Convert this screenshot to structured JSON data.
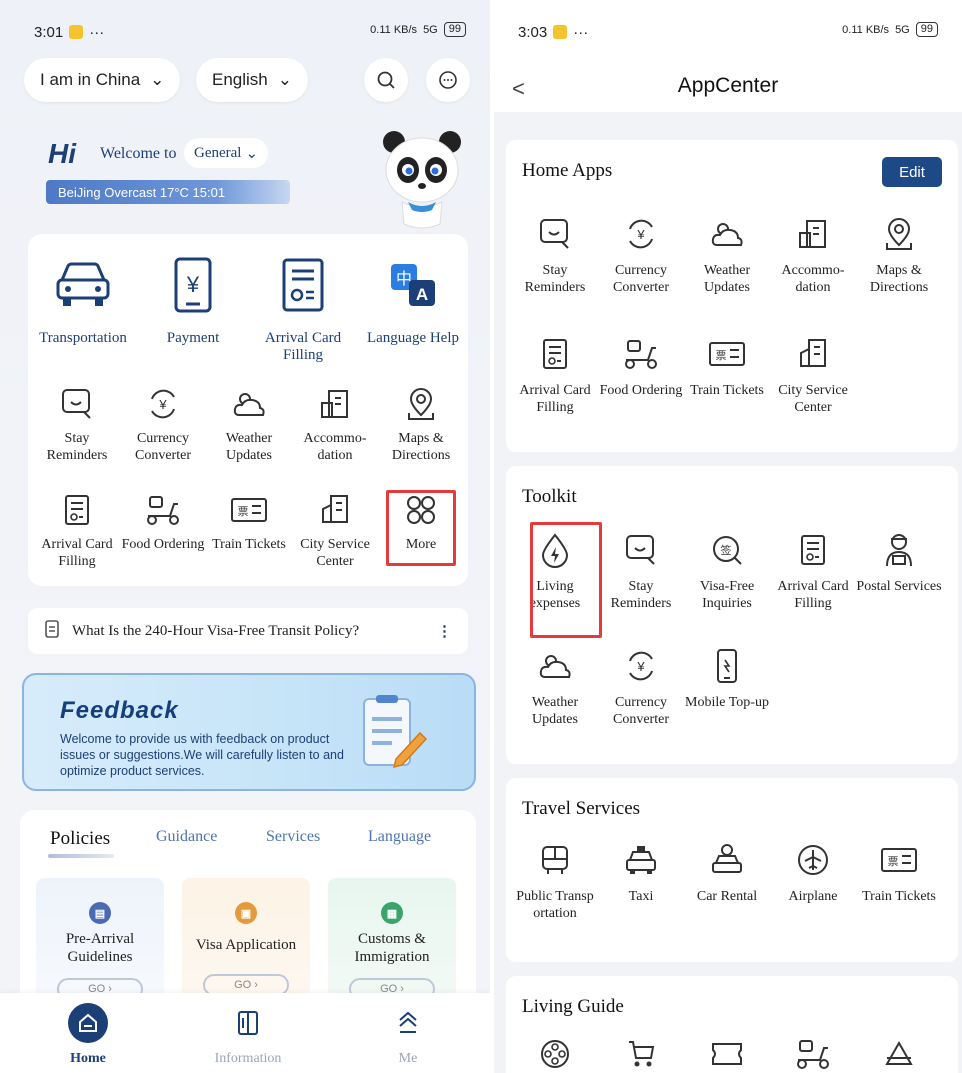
{
  "left": {
    "status": {
      "time": "3:01",
      "dots": "···",
      "network": "0.11 KB/s",
      "signal": "5G",
      "battery": "99"
    },
    "location_select": "I am in China",
    "language_select": "English",
    "greeting": {
      "hi": "Hi",
      "welcome": "Welcome to",
      "mode": "General"
    },
    "weather": "BeiJing Overcast 17°C  15:01",
    "main_services": [
      {
        "label": "Transportation"
      },
      {
        "label": "Payment"
      },
      {
        "label": "Arrival Card Filling"
      },
      {
        "label": "Language Help"
      }
    ],
    "apps_row1": [
      {
        "label": "Stay Reminders"
      },
      {
        "label": "Currency Converter"
      },
      {
        "label": "Weather Updates"
      },
      {
        "label": "Accommo- dation"
      },
      {
        "label": "Maps & Directions"
      }
    ],
    "apps_row2": [
      {
        "label": "Arrival Card Filling"
      },
      {
        "label": "Food Ordering"
      },
      {
        "label": "Train Tickets"
      },
      {
        "label": "City Service Center"
      },
      {
        "label": "More"
      }
    ],
    "policy_notice": "What Is the 240-Hour Visa-Free Transit Policy?",
    "policy_more": "⋮",
    "feedback": {
      "title": "Feedback",
      "description": "Welcome to provide us with feedback on product issues or suggestions.We will carefully listen to and optimize product services."
    },
    "tabs": [
      "Policies",
      "Guidance",
      "Services",
      "Language"
    ],
    "guide_cards": [
      {
        "title": "Pre-Arrival Guidelines",
        "go": "GO",
        "color": "#4a6bb3"
      },
      {
        "title": "Visa Application",
        "go": "GO",
        "color": "#e39a3b"
      },
      {
        "title": "Customs & Immigration",
        "go": "GO",
        "color": "#3aa46a"
      }
    ],
    "bottom_nav": [
      {
        "label": "Home",
        "icon": "home-icon"
      },
      {
        "label": "Information",
        "icon": "book-icon"
      },
      {
        "label": "Me",
        "icon": "me-icon"
      }
    ]
  },
  "right": {
    "status": {
      "time": "3:03",
      "dots": "···",
      "network": "0.11 KB/s",
      "signal": "5G",
      "battery": "99"
    },
    "back": "<",
    "title": "AppCenter",
    "home_apps": {
      "title": "Home Apps",
      "edit": "Edit",
      "row1": [
        {
          "label": "Stay Reminders"
        },
        {
          "label": "Currency Converter"
        },
        {
          "label": "Weather Updates"
        },
        {
          "label": "Accommo- dation"
        },
        {
          "label": "Maps & Directions"
        }
      ],
      "row2": [
        {
          "label": "Arrival Card Filling"
        },
        {
          "label": "Food Ordering"
        },
        {
          "label": "Train Tickets"
        },
        {
          "label": "City Service Center"
        }
      ]
    },
    "toolkit": {
      "title": "Toolkit",
      "row1": [
        {
          "label": "Living expenses"
        },
        {
          "label": "Stay Reminders"
        },
        {
          "label": "Visa-Free Inquiries"
        },
        {
          "label": "Arrival Card Filling"
        },
        {
          "label": "Postal Services"
        }
      ],
      "row2": [
        {
          "label": "Weather Updates"
        },
        {
          "label": "Currency Converter"
        },
        {
          "label": "Mobile Top-up"
        }
      ]
    },
    "travel": {
      "title": "Travel Services",
      "row1": [
        {
          "label": "Public Transp ortation"
        },
        {
          "label": "Taxi"
        },
        {
          "label": "Car Rental"
        },
        {
          "label": "Airplane"
        },
        {
          "label": "Train Tickets"
        }
      ]
    },
    "living": {
      "title": "Living Guide"
    }
  },
  "colors": {
    "navy": "#1d3f77",
    "highlight": "#e33b3b",
    "edit_button": "#1d4a86"
  }
}
